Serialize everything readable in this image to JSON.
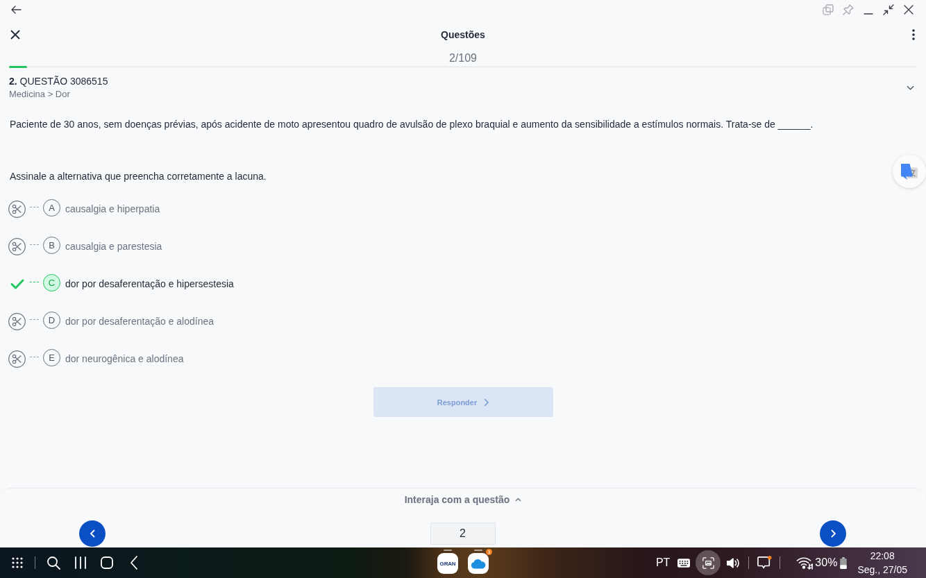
{
  "header": {
    "title": "Questões",
    "counter": "2/109",
    "progress": {
      "level": 0.02
    }
  },
  "question": {
    "title": "**2.** QUESTÃO 3086515",
    "breadcrumb": "Medicina > Dor",
    "text": "Paciente de 30 anos, sem doenças prévias, após acidente de moto apresentou quadro de avulsão de plexo braquial e aumento da sensibilidade a estímulos normais. Trata-se de ______.",
    "instruction": "Assinale a alternativa que preencha corretamente a lacuna."
  },
  "options": [
    {
      "letter": "A",
      "text": "causalgia e hiperpatia",
      "selected": false
    },
    {
      "letter": "B",
      "text": "causalgia e parestesia",
      "selected": false
    },
    {
      "letter": "C",
      "text": "dor por desaferentação e hipersestesia",
      "selected": true
    },
    {
      "letter": "D",
      "text": "dor por desaferentação e alodínea",
      "selected": false
    },
    {
      "letter": "E",
      "text": "dor neurogênica e alodínea",
      "selected": false
    }
  ],
  "answer_button": {
    "label": "Responder",
    "disabled": true
  },
  "interaction_panel": {
    "label": "Interaja com a questão"
  },
  "pagination": {
    "page": "2"
  },
  "taskbar": {
    "apps": [
      {
        "kind": "gran",
        "label": "GRAN"
      },
      {
        "kind": "cloud",
        "badge": "3"
      }
    ],
    "language": "PT",
    "battery": "30%",
    "time": "22:08",
    "date": "Seg., 27/05"
  }
}
